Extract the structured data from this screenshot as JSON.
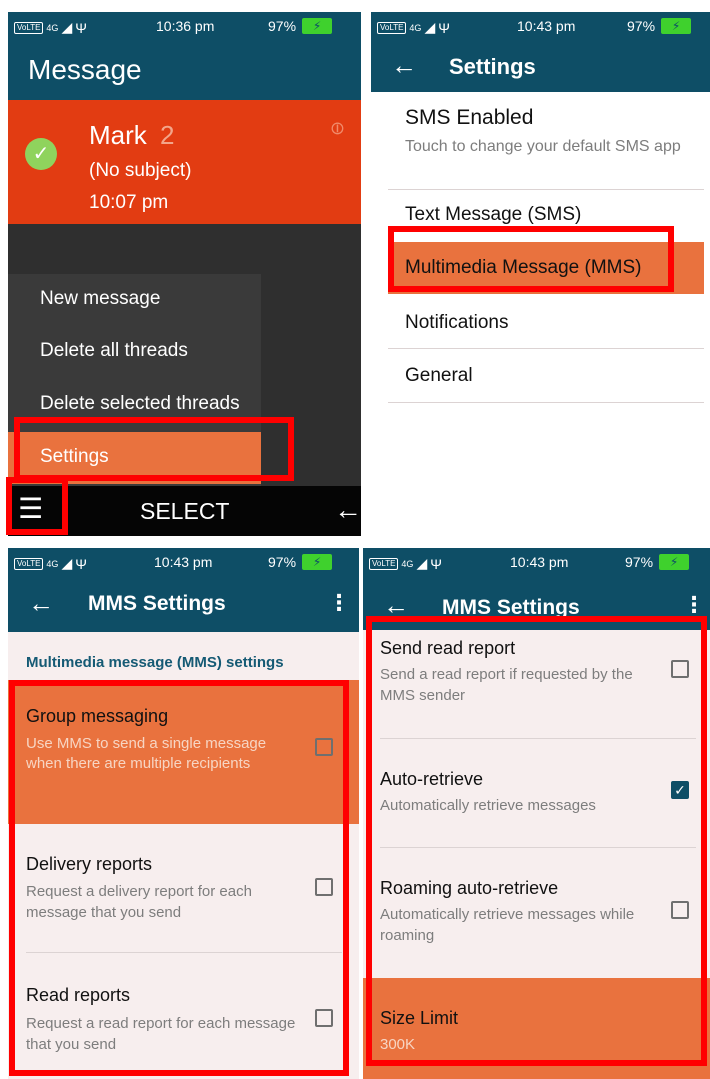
{
  "status": {
    "network": "4G",
    "volte": "VoLTE",
    "usb": "Ψ",
    "battery_percent": "97%",
    "times": [
      "10:36 pm",
      "10:43 pm",
      "10:43 pm",
      "10:43 pm"
    ]
  },
  "panel1": {
    "title": "Message",
    "thread": {
      "name": "Mark",
      "count": "2",
      "subject": "(No subject)",
      "time": "10:07 pm"
    },
    "menu": [
      "New message",
      "Delete all threads",
      "Delete selected threads",
      "Settings"
    ],
    "softkey_center": "SELECT"
  },
  "panel2": {
    "title": "Settings",
    "sms_enabled_title": "SMS Enabled",
    "sms_enabled_sub": "Touch to change your default SMS app",
    "items": [
      "Text Message (SMS)",
      "Multimedia Message (MMS)",
      "Notifications",
      "General"
    ]
  },
  "panel3": {
    "title": "MMS Settings",
    "section_header": "Multimedia message (MMS) settings",
    "items": [
      {
        "title": "Group messaging",
        "sub": "Use MMS to send a single message when there are multiple recipients",
        "checked": false
      },
      {
        "title": "Delivery reports",
        "sub": "Request a delivery report for each message that you send",
        "checked": false
      },
      {
        "title": "Read reports",
        "sub": "Request a read report for each message that you send",
        "checked": false
      }
    ]
  },
  "panel4": {
    "title": "MMS Settings",
    "items": [
      {
        "title": "Send read report",
        "sub": "Send a read report if requested by the MMS sender",
        "checked": false
      },
      {
        "title": "Auto-retrieve",
        "sub": "Automatically retrieve messages",
        "checked": true
      },
      {
        "title": "Roaming auto-retrieve",
        "sub": "Automatically retrieve messages while roaming",
        "checked": false
      }
    ],
    "size_limit_title": "Size Limit",
    "size_limit_value": "300K"
  },
  "colors": {
    "appbar": "#0e4e66",
    "accent_orange": "#e9723e",
    "thread_red": "#e23c12",
    "highlight_red": "#ff0000",
    "battery_green": "#3fd12d"
  }
}
